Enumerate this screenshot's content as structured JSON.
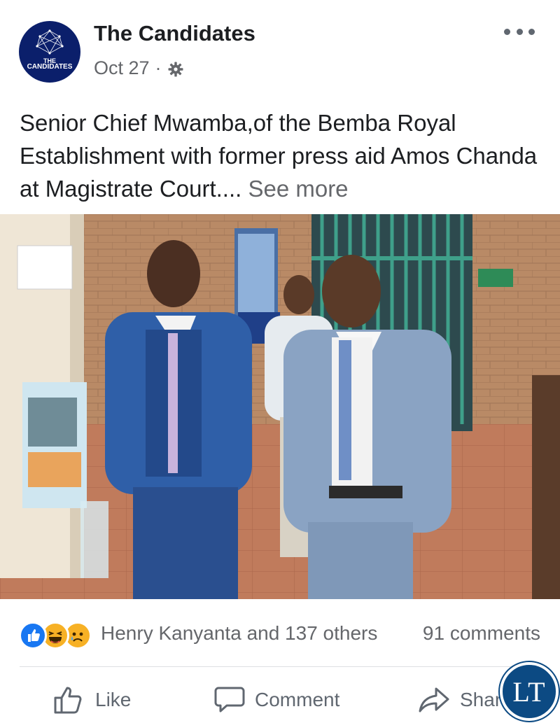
{
  "post": {
    "author": {
      "name": "The Candidates",
      "avatar_line1": "THE",
      "avatar_line2": "CANDIDATES"
    },
    "date": "Oct 27",
    "separator": "·",
    "privacy_icon": "gear-icon",
    "text": "Senior Chief Mwamba,of the Bemba Royal Establishment with former press aid Amos Chanda at Magistrate Court....",
    "see_more": "See more"
  },
  "reactions": {
    "icons": [
      "like",
      "haha",
      "sad"
    ],
    "names": "Henry Kanyanta and 137 others",
    "comments": "91 comments"
  },
  "actions": {
    "like": "Like",
    "comment": "Comment",
    "share": "Shar"
  },
  "watermark": {
    "text": "LT"
  },
  "colors": {
    "like_blue": "#1877f2",
    "text_primary": "#1c1e21",
    "text_secondary": "#65676b",
    "avatar_bg": "#0b1f6b",
    "watermark_bg": "#0c4a83"
  }
}
